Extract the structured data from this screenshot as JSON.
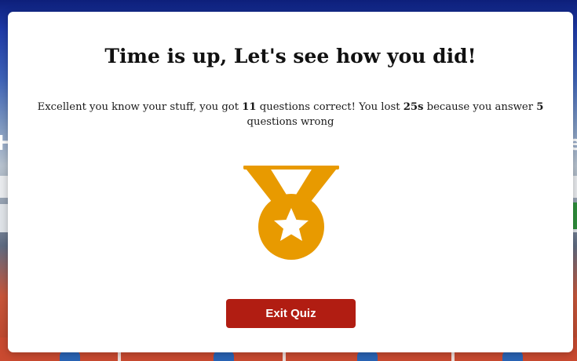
{
  "background": {
    "heading_left": "H",
    "heading_right": "e"
  },
  "modal": {
    "title": "Time is up, Let's see how you did!",
    "result": {
      "part1": "Excellent you know your stuff, you got ",
      "correct_count": "11",
      "part2": " questions correct! You lost ",
      "time_lost": "25s",
      "part3": " because you answer ",
      "wrong_count": "5",
      "part4": " questions wrong"
    },
    "medal_icon": "medal-star-icon",
    "medal_color": "#e89a00",
    "exit_button_label": "Exit Quiz",
    "exit_button_color": "#b11d12"
  }
}
